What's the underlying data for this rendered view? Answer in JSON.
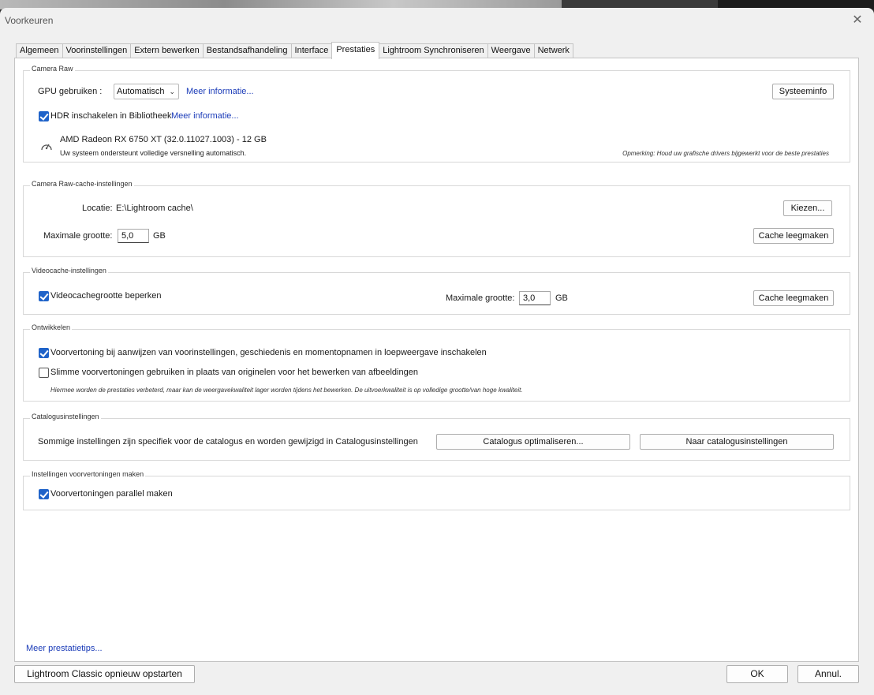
{
  "window": {
    "title": "Voorkeuren"
  },
  "tabs": [
    {
      "label": "Algemeen"
    },
    {
      "label": "Voorinstellingen"
    },
    {
      "label": "Extern bewerken"
    },
    {
      "label": "Bestandsafhandeling"
    },
    {
      "label": "Interface"
    },
    {
      "label": "Prestaties",
      "active": true
    },
    {
      "label": "Lightroom Synchroniseren"
    },
    {
      "label": "Weergave"
    },
    {
      "label": "Netwerk"
    }
  ],
  "camera_raw": {
    "title": "Camera Raw",
    "gpu_label": "GPU gebruiken :",
    "gpu_value": "Automatisch",
    "gpu_info_link": "Meer informatie...",
    "system_info_button": "Systeeminfo",
    "hdr_checked": true,
    "hdr_label": "HDR inschakelen in Bibliotheek",
    "hdr_info_link": "Meer informatie...",
    "gpu_name": "AMD Radeon RX 6750 XT (32.0.11027.1003) - 12 GB",
    "gpu_status": "Uw systeem ondersteunt volledige versnelling automatisch.",
    "note": "Opmerking: Houd uw grafische drivers bijgewerkt voor de beste prestaties"
  },
  "raw_cache": {
    "title": "Camera Raw-cache-instellingen",
    "location_label": "Locatie:",
    "location_value": "E:\\Lightroom cache\\",
    "choose_button": "Kiezen...",
    "max_size_label": "Maximale grootte:",
    "max_size_value": "5,0",
    "unit": "GB",
    "purge_button": "Cache leegmaken"
  },
  "video_cache": {
    "title": "Videocache-instellingen",
    "limit_checked": true,
    "limit_label": "Videocachegrootte beperken",
    "max_size_label": "Maximale grootte:",
    "max_size_value": "3,0",
    "unit": "GB",
    "purge_button": "Cache leegmaken"
  },
  "develop": {
    "title": "Ontwikkelen",
    "preview_checked": true,
    "preview_label": "Voorvertoning bij aanwijzen van voorinstellingen, geschiedenis en momentopnamen in loepweergave inschakelen",
    "smart_checked": false,
    "smart_label": "Slimme voorvertoningen gebruiken in plaats van originelen voor het bewerken van afbeeldingen",
    "smart_note": "Hiermee worden de prestaties verbeterd, maar kan de weergavekwaliteit lager worden tijdens het bewerken. De uitvoerkwaliteit is op volledige grootte/van hoge kwaliteit."
  },
  "catalog": {
    "title": "Catalogusinstellingen",
    "description": "Sommige instellingen zijn specifiek voor de catalogus en worden gewijzigd in Catalogusinstellingen",
    "optimize_button": "Catalogus optimaliseren...",
    "goto_button": "Naar catalogusinstellingen"
  },
  "previews": {
    "title": "Instellingen voorvertoningen maken",
    "parallel_checked": true,
    "parallel_label": "Voorvertoningen parallel maken"
  },
  "footer": {
    "tips_link": "Meer prestatietips...",
    "restart_button": "Lightroom Classic opnieuw opstarten",
    "ok_button": "OK",
    "cancel_button": "Annul."
  }
}
